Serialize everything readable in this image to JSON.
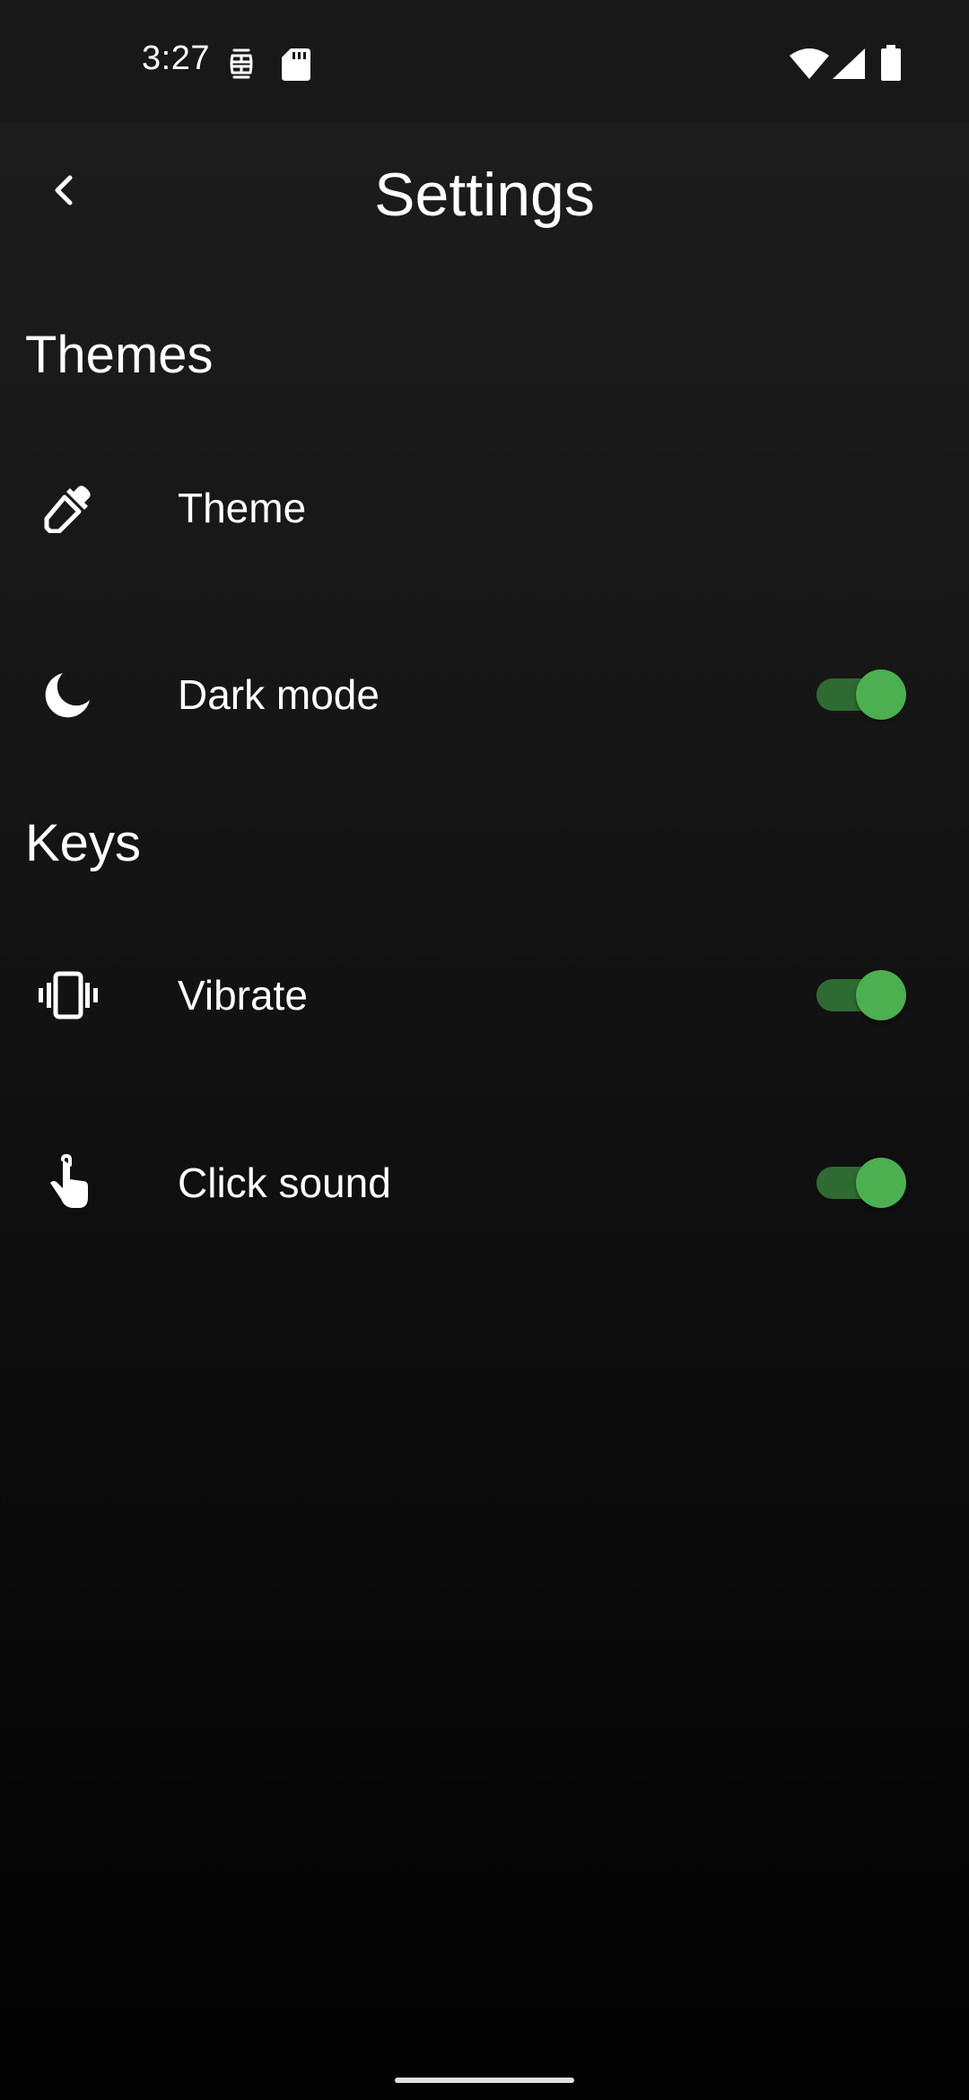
{
  "status_bar": {
    "time": "3:27",
    "icons": [
      "sim-card-managed-icon",
      "sd-card-icon",
      "wifi-icon",
      "cellular-signal-icon",
      "battery-icon"
    ]
  },
  "toolbar": {
    "back_icon": "chevron-left-icon",
    "title": "Settings"
  },
  "sections": [
    {
      "header": "Themes",
      "items": [
        {
          "icon": "eyedropper-icon",
          "label": "Theme",
          "has_toggle": false
        },
        {
          "icon": "moon-icon",
          "label": "Dark mode",
          "has_toggle": true,
          "toggle_on": true
        }
      ]
    },
    {
      "header": "Keys",
      "items": [
        {
          "icon": "vibrate-icon",
          "label": "Vibrate",
          "has_toggle": true,
          "toggle_on": true
        },
        {
          "icon": "touch-icon",
          "label": "Click sound",
          "has_toggle": true,
          "toggle_on": true
        }
      ]
    }
  ],
  "colors": {
    "toggle_thumb": "#4caf50",
    "toggle_track": "#2e6b32",
    "background_top": "#1d1d1d",
    "background_bottom": "#020202"
  }
}
